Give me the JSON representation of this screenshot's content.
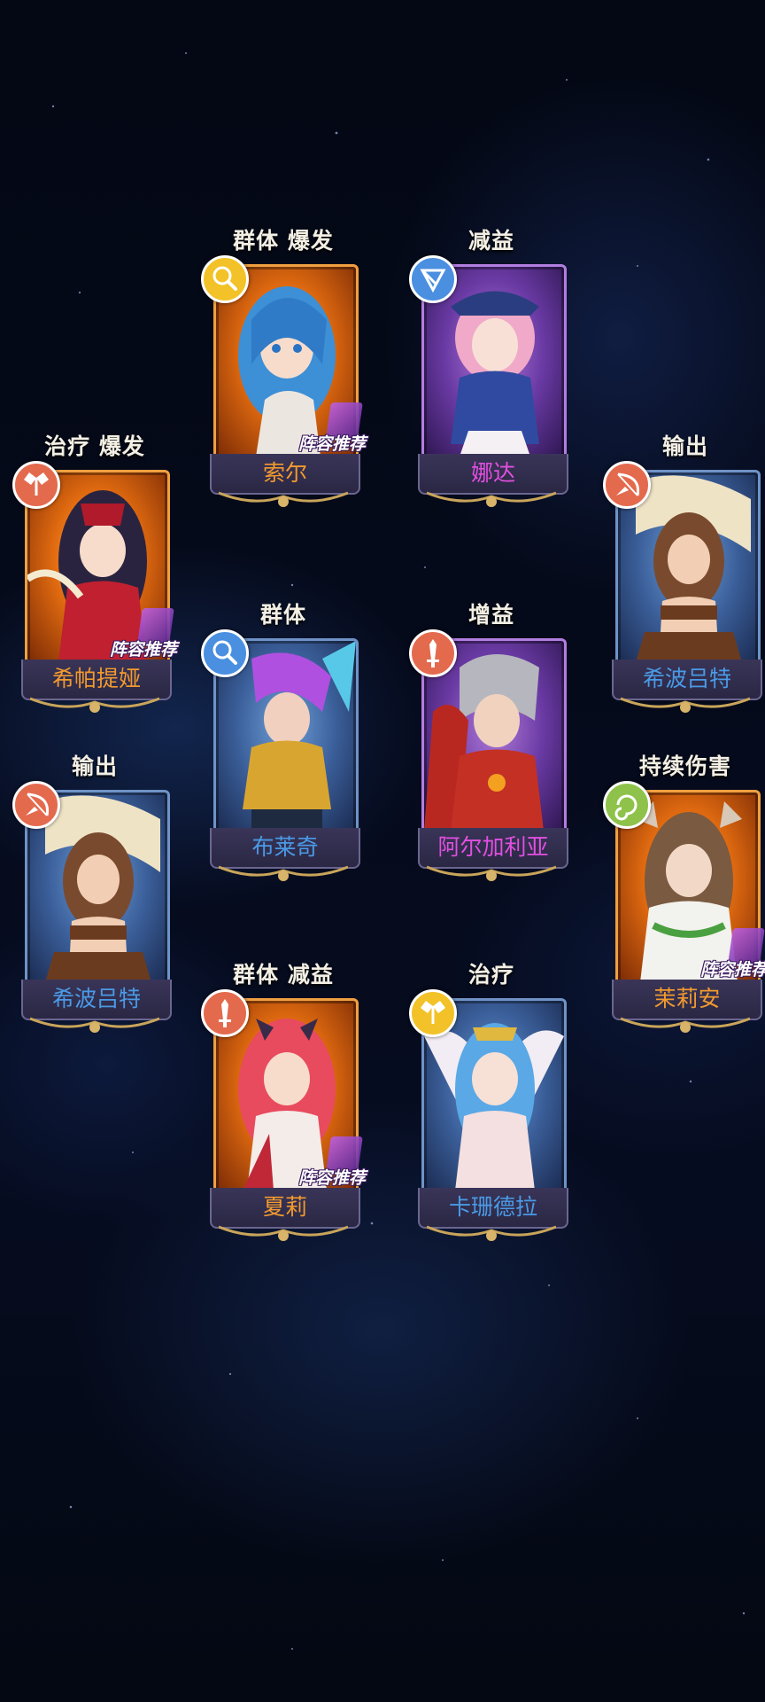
{
  "colors": {
    "name_orange": "#f29a2e",
    "name_purple": "#e24fe0",
    "name_blue": "#4a9ae6",
    "badge_yellow": "#f2c228",
    "badge_blue": "#4a8fe0",
    "badge_red": "#e46a4e",
    "badge_green": "#8ec24a"
  },
  "cards": [
    {
      "tags": "群体  爆发",
      "name": "索尔",
      "rarity": "orange",
      "badge_icon": "magnifier-icon",
      "badge_color": "#f2c228",
      "recommended": true,
      "rec_label": "阵容推荐"
    },
    {
      "tags": "减益",
      "name": "娜达",
      "rarity": "purple",
      "badge_icon": "whip-icon",
      "badge_color": "#4a8fe0",
      "recommended": false
    },
    {
      "tags": "治疗  爆发",
      "name": "希帕提娅",
      "rarity": "orange",
      "badge_icon": "angel-wings-icon",
      "badge_color": "#e46a4e",
      "recommended": true,
      "rec_label": "阵容推荐"
    },
    {
      "tags": "输出",
      "name": "希波吕特",
      "rarity": "blue",
      "badge_icon": "bow-icon",
      "badge_color": "#e46a4e",
      "recommended": false
    },
    {
      "tags": "群体",
      "name": "布莱奇",
      "rarity": "blue",
      "badge_icon": "magnifier-icon",
      "badge_color": "#4a8fe0",
      "recommended": false
    },
    {
      "tags": "增益",
      "name": "阿尔加利亚",
      "rarity": "purple",
      "badge_icon": "sword-icon",
      "badge_color": "#e46a4e",
      "recommended": false
    },
    {
      "tags": "输出",
      "name": "希波吕特",
      "rarity": "blue",
      "badge_icon": "bow-icon",
      "badge_color": "#e46a4e",
      "recommended": false
    },
    {
      "tags": "持续伤害",
      "name": "茉莉安",
      "rarity": "orange",
      "badge_icon": "spiral-icon",
      "badge_color": "#8ec24a",
      "recommended": true,
      "rec_label": "阵容推荐"
    },
    {
      "tags": "群体  减益",
      "name": "夏莉",
      "rarity": "orange",
      "badge_icon": "sword-icon",
      "badge_color": "#e46a4e",
      "recommended": true,
      "rec_label": "阵容推荐"
    },
    {
      "tags": "治疗",
      "name": "卡珊德拉",
      "rarity": "blue",
      "badge_icon": "angel-wings-icon",
      "badge_color": "#f2c228",
      "recommended": false
    }
  ]
}
